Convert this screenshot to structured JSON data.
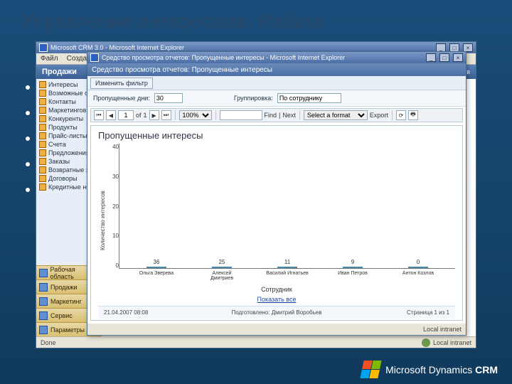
{
  "slide": {
    "title": "Управление интересами. Работа"
  },
  "outer_window": {
    "title": "Microsoft CRM 3.0 - Microsoft Internet Explorer",
    "menu": [
      "Файл",
      "Создать"
    ],
    "crm_header_title": "Продажи",
    "crm_header_user": "Пользователь: Дмитрий Воробьев",
    "status_done": "Done",
    "status_zone": "Local intranet"
  },
  "sidebar": {
    "tree": [
      "Интересы",
      "Возможные сделки",
      "Контакты",
      "Маркетинговые списки",
      "Конкуренты",
      "Продукты",
      "Прайс-листы",
      "Счета",
      "Предложения",
      "Заказы",
      "Возвратные заказы",
      "Договоры",
      "Кредитные ноты"
    ],
    "nav": [
      {
        "label": "Рабочая область"
      },
      {
        "label": "Продажи"
      },
      {
        "label": "Маркетинг"
      },
      {
        "label": "Сервис"
      },
      {
        "label": "Параметры"
      }
    ]
  },
  "inner_window": {
    "title": "Средство просмотра отчетов: Пропущенные интересы - Microsoft Internet Explorer",
    "header": "Средство просмотра отчетов: Пропущенные интересы",
    "toolbar_edit_filter": "Изменить фильтр",
    "filter1_label": "Пропущенные дни:",
    "filter1_value": "30",
    "filter2_label": "Группировка:",
    "filter2_value": "По сотруднику",
    "viewer": {
      "page_current": "1",
      "page_of_label": "of",
      "page_total": "1",
      "zoom": "100%",
      "find_label": "Find",
      "next_label": "Next",
      "format_placeholder": "Select a format",
      "export_label": "Export"
    },
    "report": {
      "title": "Пропущенные интересы",
      "y_label": "Количество интересов",
      "x_label": "Сотрудник",
      "show_all": "Показать все",
      "footer_date": "21.04.2007 08:08",
      "footer_user": "Подготовлено: Дмитрий Воробьев",
      "footer_page": "Страница 1 из 1"
    },
    "status_zone": "Local intranet"
  },
  "chart_data": {
    "type": "bar",
    "title": "Пропущенные интересы",
    "xlabel": "Сотрудник",
    "ylabel": "Количество интересов",
    "ylim": [
      0,
      40
    ],
    "yticks": [
      40,
      30,
      20,
      10,
      0
    ],
    "categories": [
      "Ольга Зверева",
      "Алексей Дмитриев",
      "Василий Игнатьев",
      "Иван Петров",
      "Антон Козлов"
    ],
    "values": [
      36,
      25,
      11,
      9,
      0
    ]
  },
  "brand": {
    "text_prefix": "Microsoft Dynamics",
    "text_suffix": " CRM"
  }
}
